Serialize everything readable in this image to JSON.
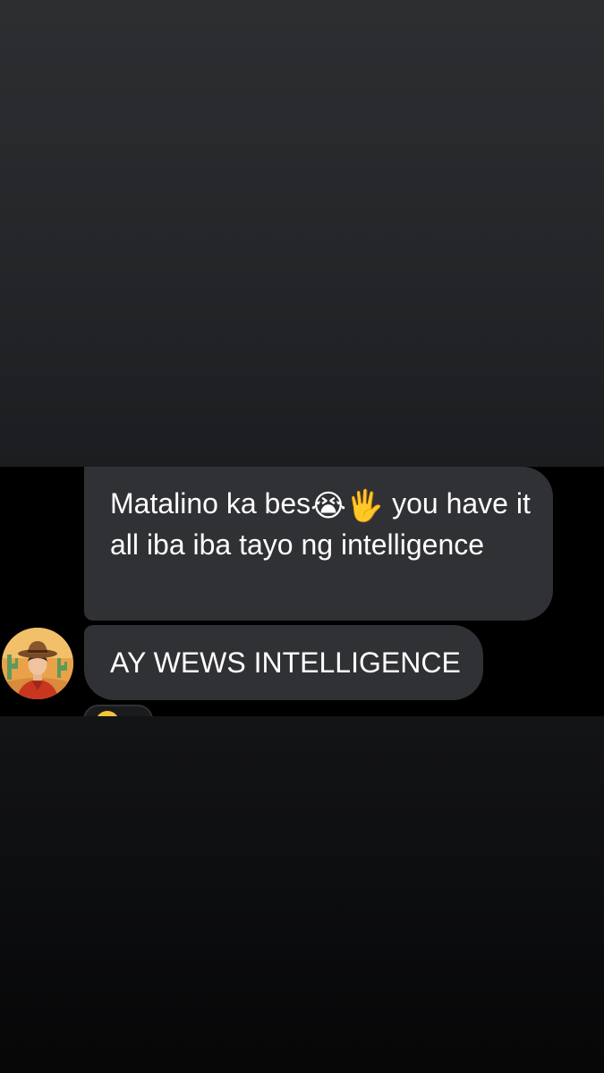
{
  "messages": [
    {
      "text_before": "Matalino ka bes",
      "emoji_1": "😭",
      "emoji_2": "🖐",
      "text_after": " you have it all iba iba tayo ng intelligence"
    },
    {
      "text": "AY WEWS INTELLIGENCE"
    }
  ],
  "sender": {
    "avatar_icon": "user-avatar-cowboy-hat-icon"
  },
  "reaction": {
    "icon": "smiley-reaction-icon",
    "color": "#f5c33b"
  },
  "colors": {
    "bubble": "#303134",
    "strip": "#000000",
    "text": "#ffffff"
  }
}
